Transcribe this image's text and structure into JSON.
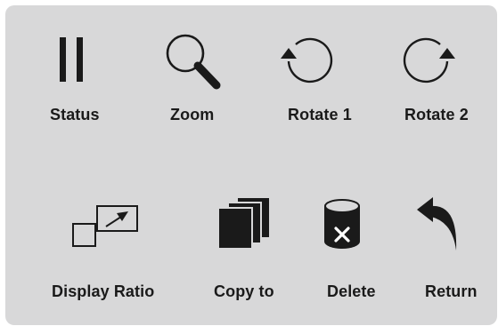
{
  "panel": {
    "background": "#d8d8d9",
    "icon_color": "#1a1a1a"
  },
  "buttons": [
    {
      "label": "Status",
      "icon": "pause-icon"
    },
    {
      "label": "Zoom",
      "icon": "magnifier-icon"
    },
    {
      "label": "Rotate 1",
      "icon": "rotate-counterclockwise-icon"
    },
    {
      "label": "Rotate 2",
      "icon": "rotate-clockwise-icon"
    },
    {
      "label": "Display Ratio",
      "icon": "display-ratio-icon"
    },
    {
      "label": "Copy to",
      "icon": "copy-icon"
    },
    {
      "label": "Delete",
      "icon": "delete-icon"
    },
    {
      "label": "Return",
      "icon": "return-icon"
    }
  ]
}
